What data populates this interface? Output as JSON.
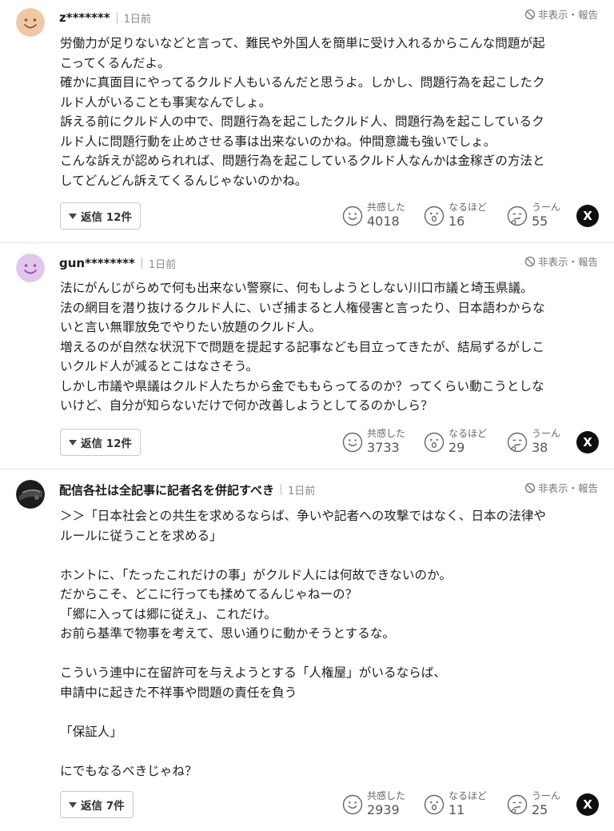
{
  "report_label": "非表示・報告",
  "comments": [
    {
      "username": "z*******",
      "time": "1日前",
      "avatar_color": "#f1c8a6",
      "body": "労働力が足りないなどと言って、難民や外国人を簡単に受け入れるからこんな問題が起\nこってくるんだよ。\n確かに真面目にやってるクルド人もいるんだと思うよ。しかし、問題行為を起こしたク\nルド人がいることも事実なんでしょ。\n訴える前にクルド人の中で、問題行為を起こしたクルド人、問題行為を起こしているク\nルド人に問題行動を止めさせる事は出来ないのかね。仲間意識も強いでしょ。\nこんな訴えが認められれば、問題行為を起こしているクルド人なんかは金稼ぎの方法と\nしてどんどん訴えてくるんじゃないのかね。",
      "reply_label": "返信 12件",
      "empathy_label": "共感した",
      "empathy_count": "4018",
      "naruhodo_label": "なるほど",
      "naruhodo_count": "16",
      "uun_label": "うーん",
      "uun_count": "55"
    },
    {
      "username": "gun********",
      "time": "1日前",
      "avatar_color": "#e2c6ef",
      "body": "法にがんじがらめで何も出来ない警察に、何もしようとしない川口市議と埼玉県議。\n法の網目を潜り抜けるクルド人に、いざ捕まると人権侵害と言ったり、日本語わからな\nいと言い無罪放免でやりたい放題のクルド人。\n増えるのが自然な状況下で問題を提起する記事なども目立ってきたが、結局ずるがしこ\nいクルド人が減るとこはなさそう。\nしかし市議や県議はクルド人たちから金でももらってるのか？ってくらい動こうとしな\nいけど、自分が知らないだけで何か改善しようとしてるのかしら？",
      "reply_label": "返信 12件",
      "empathy_label": "共感した",
      "empathy_count": "3733",
      "naruhodo_label": "なるほど",
      "naruhodo_count": "29",
      "uun_label": "うーん",
      "uun_count": "38"
    },
    {
      "username": "配信各社は全記事に記者名を併記すべき",
      "time": "1日前",
      "avatar_color": "#1c1c1c",
      "body": "＞＞「日本社会との共生を求めるならば、争いや記者への攻撃ではなく、日本の法律や\nルールに従うことを求める」\n\nホントに、「たったこれだけの事」がクルド人には何故できないのか。\nだからこそ、どこに行っても揉めてるんじゃねーの？\n「郷に入っては郷に従え」、これだけ。\nお前ら基準で物事を考えて、思い通りに動かそうとするな。\n\nこういう連中に在留許可を与えようとする「人権屋」がいるならば、\n申請中に起きた不祥事や問題の責任を負う\n\n「保証人」\n\nにでもなるべきじゃね？",
      "reply_label": "返信 7件",
      "empathy_label": "共感した",
      "empathy_count": "2939",
      "naruhodo_label": "なるほど",
      "naruhodo_count": "11",
      "uun_label": "うーん",
      "uun_count": "25"
    }
  ],
  "share_x_label": "X"
}
